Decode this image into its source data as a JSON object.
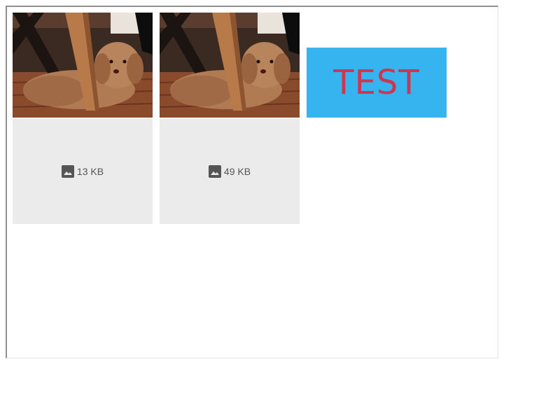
{
  "images": [
    {
      "alt_label": "puppy-photo-1"
    },
    {
      "alt_label": "puppy-photo-2"
    }
  ],
  "placeholders": [
    {
      "icon": "image-icon",
      "size": "13 KB"
    },
    {
      "icon": "image-icon",
      "size": "49 KB"
    }
  ],
  "test_banner": {
    "text": "TEST",
    "background": "#35b4ef",
    "text_color": "#d2334f"
  }
}
